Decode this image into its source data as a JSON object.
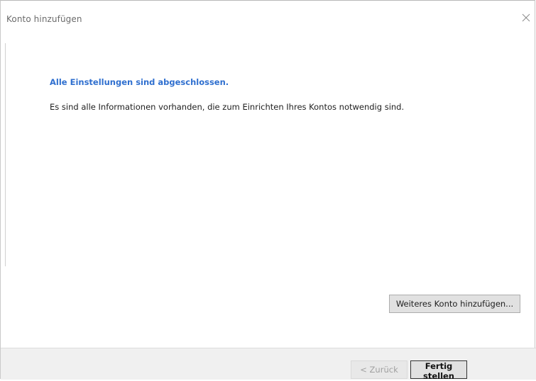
{
  "window": {
    "title": "Konto hinzufügen",
    "close_icon": "close-icon"
  },
  "main": {
    "heading": "Alle Einstellungen sind abgeschlossen.",
    "info": "Es sind alle Informationen vorhanden, die zum Einrichten Ihres Kontos notwendig sind.",
    "add_account_label": "Weiteres Konto hinzufügen..."
  },
  "footer": {
    "back_label": "< Zurück",
    "finish_label": "Fertig stellen"
  },
  "colors": {
    "heading": "#2f6fcf",
    "footer_bg": "#f0f0f0"
  }
}
